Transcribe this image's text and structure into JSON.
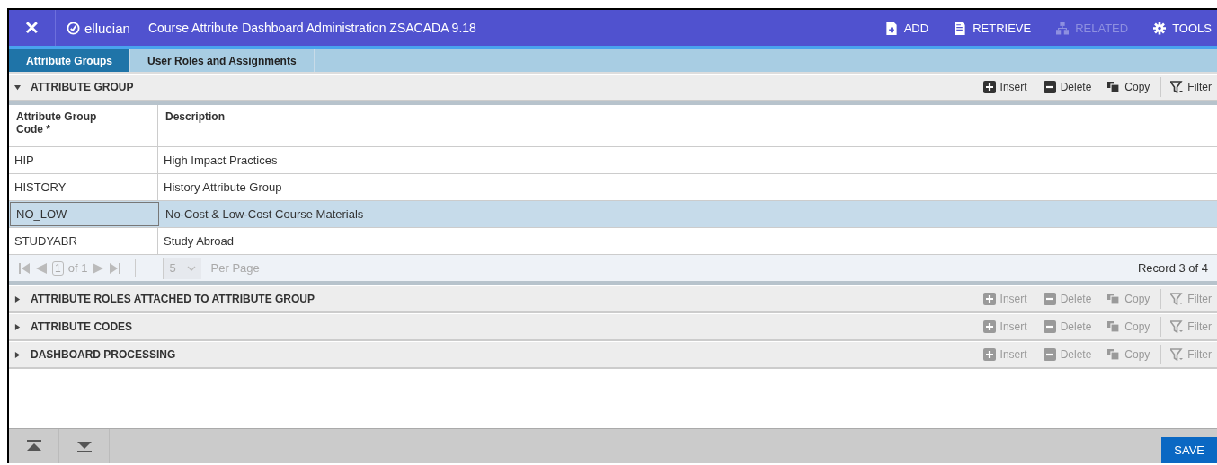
{
  "header": {
    "close": "✕",
    "brand": "ellucian",
    "title": "Course Attribute Dashboard Administration ZSACADA 9.18",
    "actions": [
      {
        "kind": "add",
        "label": "ADD",
        "disabled": false
      },
      {
        "kind": "retrieve",
        "label": "RETRIEVE",
        "disabled": false
      },
      {
        "kind": "related",
        "label": "RELATED",
        "disabled": true
      },
      {
        "kind": "tools",
        "label": "TOOLS",
        "disabled": false
      }
    ]
  },
  "tabs": [
    {
      "label": "Attribute Groups",
      "selected": true
    },
    {
      "label": "User Roles and Assignments",
      "selected": false
    }
  ],
  "sections": [
    {
      "title": "ATTRIBUTE GROUP",
      "expanded": true,
      "tools_disabled": false,
      "tools": [
        {
          "kind": "insert",
          "label": "Insert"
        },
        {
          "kind": "delete",
          "label": "Delete"
        },
        {
          "kind": "copy",
          "label": "Copy"
        },
        {
          "kind": "filter",
          "label": "Filter"
        }
      ],
      "table": {
        "columns": [
          "Attribute Group Code *",
          "Description"
        ],
        "rows": [
          {
            "cells": [
              "HIP",
              "High Impact Practices"
            ],
            "selected": false
          },
          {
            "cells": [
              "HISTORY",
              "History Attribute Group"
            ],
            "selected": false
          },
          {
            "cells": [
              "NO_LOW",
              "No-Cost & Low-Cost Course Materials"
            ],
            "selected": true
          },
          {
            "cells": [
              "STUDYABR",
              "Study Abroad"
            ],
            "selected": false
          }
        ]
      },
      "pager": {
        "page": "1",
        "of": "of 1",
        "per_page_value": "5",
        "per_page": "Per Page",
        "record": "Record 3 of 4"
      }
    },
    {
      "title": "ATTRIBUTE ROLES ATTACHED TO ATTRIBUTE GROUP",
      "expanded": false,
      "tools_disabled": true,
      "tools": [
        {
          "kind": "insert",
          "label": "Insert"
        },
        {
          "kind": "delete",
          "label": "Delete"
        },
        {
          "kind": "copy",
          "label": "Copy"
        },
        {
          "kind": "filter",
          "label": "Filter"
        }
      ]
    },
    {
      "title": "ATTRIBUTE CODES",
      "expanded": false,
      "tools_disabled": true,
      "tools": [
        {
          "kind": "insert",
          "label": "Insert"
        },
        {
          "kind": "delete",
          "label": "Delete"
        },
        {
          "kind": "copy",
          "label": "Copy"
        },
        {
          "kind": "filter",
          "label": "Filter"
        }
      ]
    },
    {
      "title": "DASHBOARD PROCESSING",
      "expanded": false,
      "tools_disabled": true,
      "tools": [
        {
          "kind": "insert",
          "label": "Insert"
        },
        {
          "kind": "delete",
          "label": "Delete"
        },
        {
          "kind": "copy",
          "label": "Copy"
        },
        {
          "kind": "filter",
          "label": "Filter"
        }
      ]
    }
  ],
  "footer": {
    "save": "SAVE"
  }
}
